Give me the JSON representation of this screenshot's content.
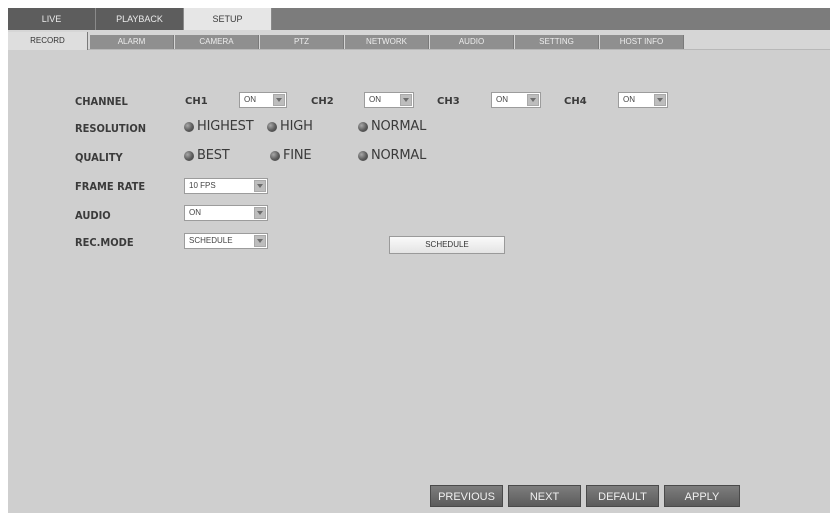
{
  "top_tabs": {
    "live": "LIVE",
    "playback": "PLAYBACK",
    "setup": "SETUP"
  },
  "sub_tabs": {
    "record": "RECORD",
    "alarm": "ALARM",
    "camera": "CAMERA",
    "ptz": "PTZ",
    "network": "NETWORK",
    "audio": "AUDIO",
    "setting": "SETTING",
    "host_info": "HOST INFO"
  },
  "record": {
    "channel_label": "CHANNEL",
    "channels": [
      {
        "name": "CH1",
        "value": "ON"
      },
      {
        "name": "CH2",
        "value": "ON"
      },
      {
        "name": "CH3",
        "value": "ON"
      },
      {
        "name": "CH4",
        "value": "ON"
      }
    ],
    "resolution_label": "RESOLUTION",
    "resolution_options": [
      "HIGHEST",
      "HIGH",
      "NORMAL"
    ],
    "quality_label": "QUALITY",
    "quality_options": [
      "BEST",
      "FINE",
      "NORMAL"
    ],
    "frame_rate_label": "FRAME RATE",
    "frame_rate_value": "10 FPS",
    "audio_label": "AUDIO",
    "audio_value": "ON",
    "rec_mode_label": "REC.MODE",
    "rec_mode_value": "SCHEDULE",
    "schedule_button": "SCHEDULE"
  },
  "footer": {
    "previous": "PREVIOUS",
    "next": "NEXT",
    "default": "DEFAULT",
    "apply": "APPLY"
  },
  "colors": {
    "panel_bg": "#cfcfcf",
    "tab_bar": "#7c7c7c",
    "button_dark": "#5c5c5c"
  },
  "icons": {
    "dropdown": "chevron-down-icon",
    "radio": "radio-dot-icon"
  }
}
